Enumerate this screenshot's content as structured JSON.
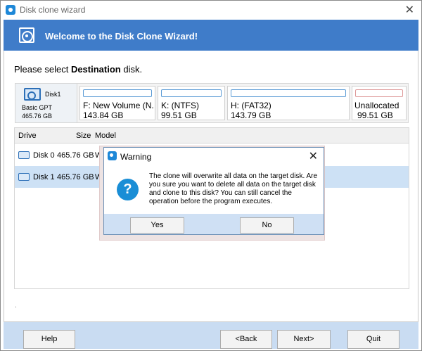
{
  "window": {
    "title": "Disk clone wizard",
    "close_glyph": "✕"
  },
  "banner": {
    "heading": "Welcome to the Disk Clone Wizard!"
  },
  "prompt": {
    "prefix": "Please select ",
    "emphasis": "Destination",
    "suffix": " disk."
  },
  "disk_map": {
    "disk_name": "Disk1",
    "disk_type": "Basic GPT",
    "disk_size": "465.76 GB",
    "partitions": [
      {
        "label": "F: New Volume (N...",
        "size": "143.84 GB"
      },
      {
        "label": "K: (NTFS)",
        "size": "99.51 GB"
      },
      {
        "label": "H: (FAT32)",
        "size": "143.79 GB"
      },
      {
        "label": "Unallocated",
        "size": "99.51 GB"
      }
    ]
  },
  "table": {
    "columns": [
      "Drive",
      "Size",
      "Model"
    ],
    "rows": [
      {
        "drive": "Disk 0",
        "size": "465.76 GB",
        "model": "WD"
      },
      {
        "drive": "Disk 1",
        "size": "465.76 GB",
        "model": "WD"
      }
    ],
    "selected_row": 1
  },
  "footer_marker": ".",
  "buttons": {
    "help": "Help",
    "back": "<Back",
    "next": "Next>",
    "quit": "Quit"
  },
  "dialog": {
    "title": "Warning",
    "close_glyph": "✕",
    "icon_glyph": "?",
    "message": "The clone will overwrite all data on the target disk. Are you sure you want to delete all data on the target disk and clone to this disk? You can still cancel the operation before the program executes.",
    "yes": "Yes",
    "no": "No"
  },
  "colors": {
    "banner": "#3f7cc9",
    "footer": "#c9dcf2",
    "selected_row": "#cde1f5",
    "icon_blue": "#1a8ed6"
  }
}
